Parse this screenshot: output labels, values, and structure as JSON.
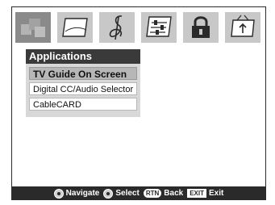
{
  "icon_tabs": [
    {
      "name": "applications-icon",
      "active": true
    },
    {
      "name": "picture-icon",
      "active": false
    },
    {
      "name": "sound-icon",
      "active": false
    },
    {
      "name": "setup-icon",
      "active": false
    },
    {
      "name": "lock-icon",
      "active": false
    },
    {
      "name": "channel-input-icon",
      "active": false
    }
  ],
  "menu": {
    "title": "Applications",
    "items": [
      {
        "label": "TV Guide On Screen",
        "selected": true
      },
      {
        "label": "Digital CC/Audio Selector",
        "selected": false
      },
      {
        "label": "CableCARD",
        "selected": false
      }
    ]
  },
  "footer": {
    "navigate_label": "Navigate",
    "select_label": "Select",
    "rtn_key": "RTN",
    "back_label": "Back",
    "exit_key": "EXIT",
    "exit_label": "Exit"
  },
  "colors": {
    "header_bg": "#3a3a3a",
    "panel_bg": "#d8d8d8",
    "selected_bg": "#b7b7b7",
    "footer_bg": "#2a2a2a",
    "icon_active": "#8a8a8a",
    "icon_inactive": "#c8c8c8"
  }
}
